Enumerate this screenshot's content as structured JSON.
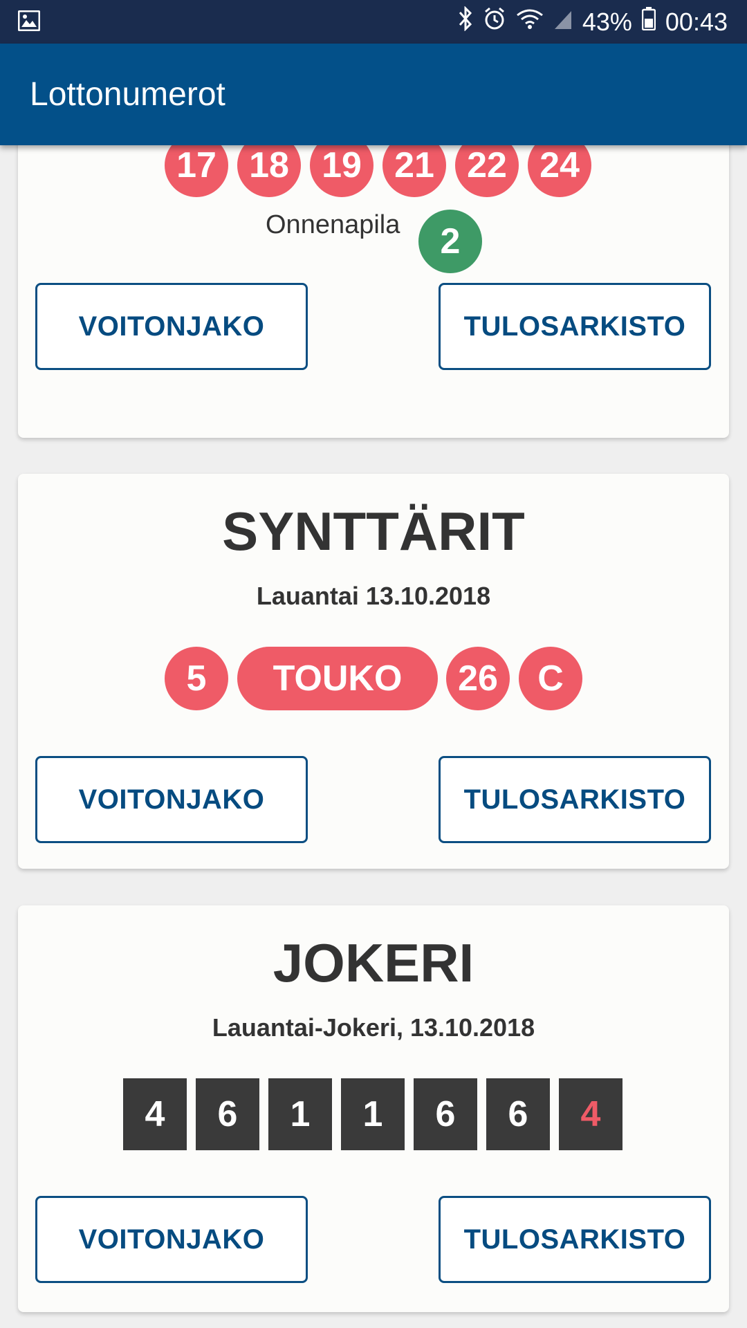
{
  "status_bar": {
    "battery": "43%",
    "time": "00:43",
    "icons": [
      "image-icon",
      "bluetooth-icon",
      "alarm-icon",
      "wifi-icon",
      "signal-icon",
      "battery-icon"
    ]
  },
  "app_bar": {
    "title": "Lottonumerot"
  },
  "lotto": {
    "numbers": [
      "17",
      "18",
      "19",
      "21",
      "22",
      "24"
    ],
    "clover_label": "Onnenapila",
    "clover_number": "2",
    "button_left": "VOITONJAKO",
    "button_right": "TULOSARKISTO"
  },
  "synttarit": {
    "title": "SYNTTÄRIT",
    "date": "Lauantai 13.10.2018",
    "balls": [
      "5",
      "TOUKO",
      "26",
      "C"
    ],
    "button_left": "VOITONJAKO",
    "button_right": "TULOSARKISTO"
  },
  "jokeri": {
    "title": "JOKERI",
    "date": "Lauantai-Jokeri, 13.10.2018",
    "digits": [
      "4",
      "6",
      "1",
      "1",
      "6",
      "6",
      "4"
    ],
    "button_left": "VOITONJAKO",
    "button_right": "TULOSARKISTO"
  },
  "colors": {
    "app_bar": "#035089",
    "ball_red": "#ef5b67",
    "ball_green": "#3e9a66",
    "button_text": "#064b80",
    "jokeri_box": "#3a3a3a"
  }
}
